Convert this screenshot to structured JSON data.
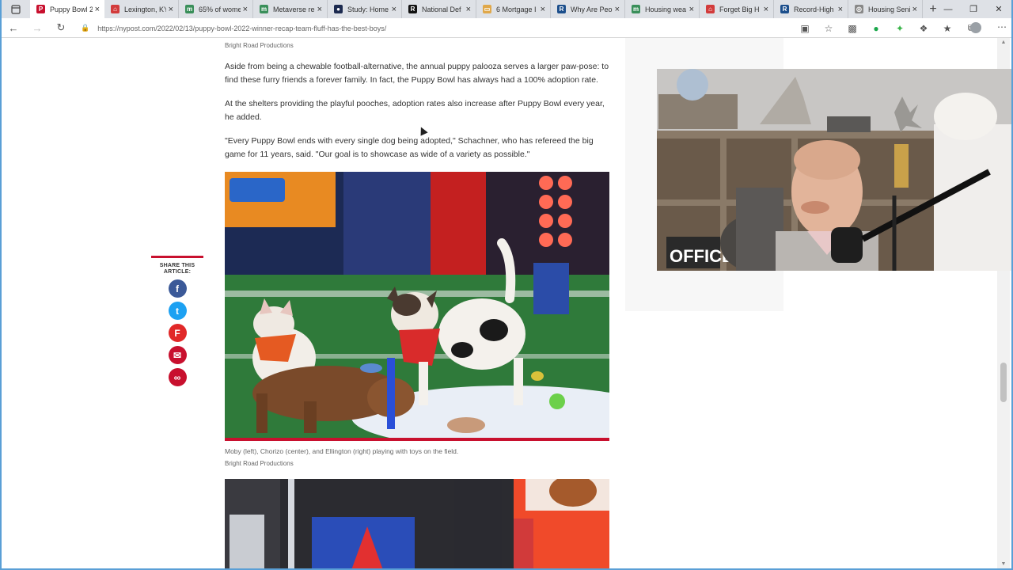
{
  "browser": {
    "tabs": [
      {
        "label": "Puppy Bowl 2",
        "favicon_color": "#c8102e",
        "favicon_glyph": "P",
        "active": true
      },
      {
        "label": "Lexington, KY",
        "favicon_color": "#d23b3b",
        "favicon_glyph": "⌂",
        "active": false
      },
      {
        "label": "65% of wome",
        "favicon_color": "#3a8f5a",
        "favicon_glyph": "m",
        "active": false
      },
      {
        "label": "Metaverse re",
        "favicon_color": "#3a8f5a",
        "favicon_glyph": "m",
        "active": false
      },
      {
        "label": "Study: Home",
        "favicon_color": "#1d2b50",
        "favicon_glyph": "●",
        "active": false
      },
      {
        "label": "National Def",
        "favicon_color": "#111111",
        "favicon_glyph": "R",
        "active": false
      },
      {
        "label": "6 Mortgage I",
        "favicon_color": "#e0a84a",
        "favicon_glyph": "▭",
        "active": false
      },
      {
        "label": "Why Are Peo",
        "favicon_color": "#1c4f8c",
        "favicon_glyph": "R",
        "active": false
      },
      {
        "label": "Housing wea",
        "favicon_color": "#3a8f5a",
        "favicon_glyph": "m",
        "active": false
      },
      {
        "label": "Forget Big H",
        "favicon_color": "#d23b3b",
        "favicon_glyph": "⌂",
        "active": false
      },
      {
        "label": "Record-High",
        "favicon_color": "#1c4f8c",
        "favicon_glyph": "R",
        "active": false
      },
      {
        "label": "Housing Seni",
        "favicon_color": "#888888",
        "favicon_glyph": "◎",
        "active": false
      }
    ],
    "new_tab_glyph": "+",
    "url": "https://nypost.com/2022/02/13/puppy-bowl-2022-winner-recap-team-fluff-has-the-best-boys/"
  },
  "article": {
    "credit_top": "Bright Road Productions",
    "paragraphs": [
      "Aside from being a chewable football-alternative, the annual puppy palooza serves a larger paw-pose: to find these furry friends a forever family. In fact, the Puppy Bowl has always had a 100% adoption rate.",
      "At the shelters providing the playful pooches, adoption rates also increase after Puppy Bowl every year, he added.",
      "\"Every Puppy Bowl ends with every single dog being adopted,\" Schachner, who has refereed the big game for 11 years, said. \"Our goal is to showcase as wide of a variety as possible.\""
    ],
    "photo_caption": "Moby (left), Chorizo (center), and Ellington (right) playing with toys on the field.",
    "photo_credit": "Bright Road Productions"
  },
  "share": {
    "label": "SHARE THIS ARTICLE:",
    "icons": [
      {
        "name": "facebook-icon",
        "color": "#3b5998",
        "glyph": "f"
      },
      {
        "name": "twitter-icon",
        "color": "#1da1f2",
        "glyph": "t"
      },
      {
        "name": "flipboard-icon",
        "color": "#e12828",
        "glyph": "F"
      },
      {
        "name": "email-icon",
        "color": "#c8102e",
        "glyph": "✉"
      },
      {
        "name": "link-icon",
        "color": "#c8102e",
        "glyph": "∞"
      }
    ]
  },
  "webcam": {
    "sign_text": "OFFICE"
  }
}
